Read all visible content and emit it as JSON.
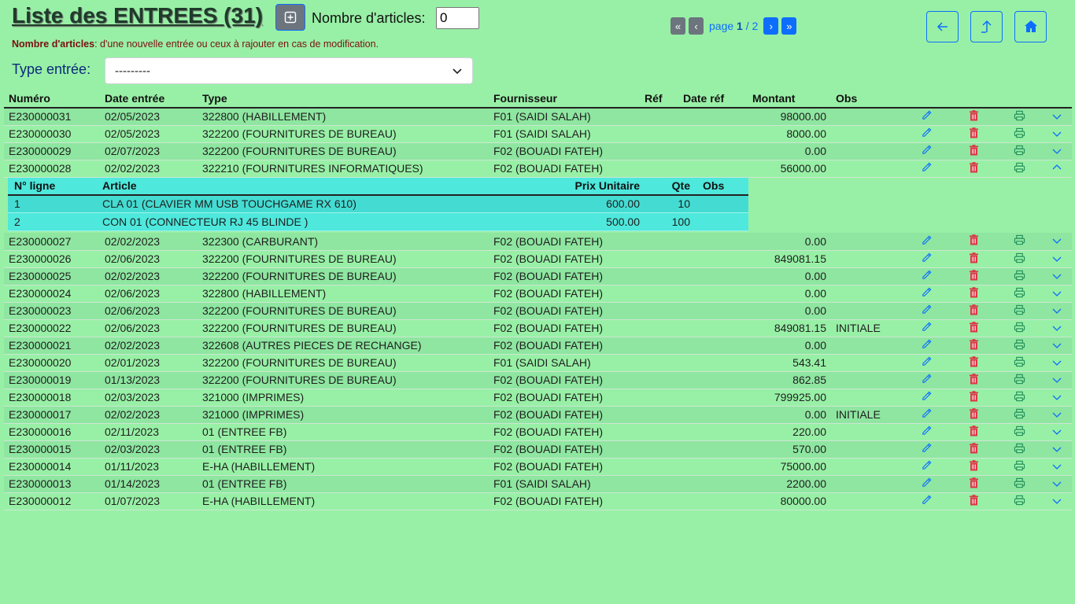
{
  "header": {
    "title": "Liste des ENTREES (31)",
    "nb_label": "Nombre d'articles:",
    "nb_value": "0",
    "note_bold": "Nombre d'articles",
    "note_text": ": d'une nouvelle entrée ou ceux à rajouter en cas de modification."
  },
  "pager": {
    "prefix": "page",
    "current": "1",
    "separator": " / 2"
  },
  "filter": {
    "label": "Type entrée:",
    "selected": "---------"
  },
  "table": {
    "columns": [
      "Numéro",
      "Date entrée",
      "Type",
      "Fournisseur",
      "Réf",
      "Date réf",
      "Montant",
      "Obs"
    ],
    "rows": [
      [
        "E230000031",
        "02/05/2023",
        "322800 (HABILLEMENT)",
        "F01 (SAIDI SALAH)",
        "",
        "",
        "98000.00",
        ""
      ],
      [
        "E230000030",
        "02/05/2023",
        "322200 (FOURNITURES DE BUREAU)",
        "F01 (SAIDI SALAH)",
        "",
        "",
        "8000.00",
        ""
      ],
      [
        "E230000029",
        "02/07/2023",
        "322200 (FOURNITURES DE BUREAU)",
        "F02 (BOUADI FATEH)",
        "",
        "",
        "0.00",
        ""
      ],
      [
        "E230000028",
        "02/02/2023",
        "322210 (FOURNITURES INFORMATIQUES)",
        "F02 (BOUADI FATEH)",
        "",
        "",
        "56000.00",
        ""
      ],
      [
        "E230000027",
        "02/02/2023",
        "322300 (CARBURANT)",
        "F02 (BOUADI FATEH)",
        "",
        "",
        "0.00",
        ""
      ],
      [
        "E230000026",
        "02/06/2023",
        "322200 (FOURNITURES DE BUREAU)",
        "F02 (BOUADI FATEH)",
        "",
        "",
        "849081.15",
        ""
      ],
      [
        "E230000025",
        "02/02/2023",
        "322200 (FOURNITURES DE BUREAU)",
        "F02 (BOUADI FATEH)",
        "",
        "",
        "0.00",
        ""
      ],
      [
        "E230000024",
        "02/06/2023",
        "322800 (HABILLEMENT)",
        "F02 (BOUADI FATEH)",
        "",
        "",
        "0.00",
        ""
      ],
      [
        "E230000023",
        "02/06/2023",
        "322200 (FOURNITURES DE BUREAU)",
        "F02 (BOUADI FATEH)",
        "",
        "",
        "0.00",
        ""
      ],
      [
        "E230000022",
        "02/06/2023",
        "322200 (FOURNITURES DE BUREAU)",
        "F02 (BOUADI FATEH)",
        "",
        "",
        "849081.15",
        "INITIALE"
      ],
      [
        "E230000021",
        "02/02/2023",
        "322608 (AUTRES PIECES DE RECHANGE)",
        "F02 (BOUADI FATEH)",
        "",
        "",
        "0.00",
        ""
      ],
      [
        "E230000020",
        "02/01/2023",
        "322200 (FOURNITURES DE BUREAU)",
        "F01 (SAIDI SALAH)",
        "",
        "",
        "543.41",
        ""
      ],
      [
        "E230000019",
        "01/13/2023",
        "322200 (FOURNITURES DE BUREAU)",
        "F02 (BOUADI FATEH)",
        "",
        "",
        "862.85",
        ""
      ],
      [
        "E230000018",
        "02/03/2023",
        "321000 (IMPRIMES)",
        "F02 (BOUADI FATEH)",
        "",
        "",
        "799925.00",
        ""
      ],
      [
        "E230000017",
        "02/02/2023",
        "321000 (IMPRIMES)",
        "F02 (BOUADI FATEH)",
        "",
        "",
        "0.00",
        "INITIALE"
      ],
      [
        "E230000016",
        "02/11/2023",
        "01 (ENTREE FB)",
        "F02 (BOUADI FATEH)",
        "",
        "",
        "220.00",
        ""
      ],
      [
        "E230000015",
        "02/03/2023",
        "01 (ENTREE FB)",
        "F02 (BOUADI FATEH)",
        "",
        "",
        "570.00",
        ""
      ],
      [
        "E230000014",
        "01/11/2023",
        "E-HA (HABILLEMENT)",
        "F02 (BOUADI FATEH)",
        "",
        "",
        "75000.00",
        ""
      ],
      [
        "E230000013",
        "01/14/2023",
        "01 (ENTREE FB)",
        "F01 (SAIDI SALAH)",
        "",
        "",
        "2200.00",
        ""
      ],
      [
        "E230000012",
        "01/07/2023",
        "E-HA (HABILLEMENT)",
        "F02 (BOUADI FATEH)",
        "",
        "",
        "80000.00",
        ""
      ]
    ],
    "expanded_row": 3
  },
  "detail": {
    "columns": [
      "N° ligne",
      "Article",
      "Prix Unitaire",
      "Qte",
      "Obs"
    ],
    "rows": [
      [
        "1",
        "CLA 01 (CLAVIER MM USB TOUCHGAME RX 610)",
        "600.00",
        "10",
        ""
      ],
      [
        "2",
        "CON 01 (CONNECTEUR RJ 45 BLINDE )",
        "500.00",
        "100",
        ""
      ]
    ]
  },
  "icons": {
    "add": "plus-square-icon",
    "edit": "pencil-icon",
    "delete": "trash-icon",
    "print": "printer-icon",
    "expand": "chevron-down-icon",
    "collapse": "chevron-up-icon",
    "back": "arrow-left-icon",
    "up": "arrow-up-icon",
    "home": "home-icon"
  },
  "colors": {
    "background": "#98f0a6",
    "detail_bg": "#4ee8dc",
    "accent": "#0d6efd",
    "danger": "#dc3545"
  }
}
